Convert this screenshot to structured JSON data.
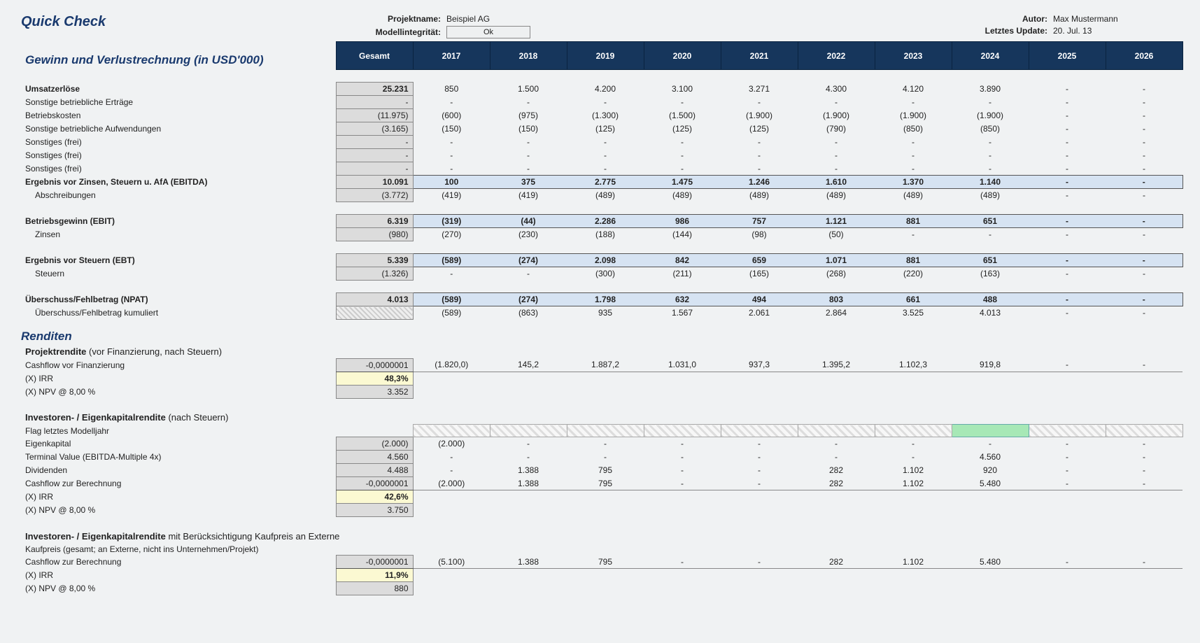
{
  "header": {
    "title": "Quick Check",
    "projectLabel": "Projektname:",
    "project": "Beispiel AG",
    "integrityLabel": "Modellintegrität:",
    "integrity": "Ok",
    "authorLabel": "Autor:",
    "author": "Max Mustermann",
    "updateLabel": "Letztes Update:",
    "update": "20. Jul. 13"
  },
  "section1": "Gewinn und Verlustrechnung (in USD'000)",
  "cols": {
    "gesamt": "Gesamt",
    "y": [
      "2017",
      "2018",
      "2019",
      "2020",
      "2021",
      "2022",
      "2023",
      "2024",
      "2025",
      "2026"
    ]
  },
  "pl": {
    "r1": {
      "lbl": "Umsatzerlöse",
      "g": "25.231",
      "v": [
        "850",
        "1.500",
        "4.200",
        "3.100",
        "3.271",
        "4.300",
        "4.120",
        "3.890",
        "-",
        "-"
      ]
    },
    "r2": {
      "lbl": "Sonstige betriebliche Erträge",
      "g": "-",
      "v": [
        "-",
        "-",
        "-",
        "-",
        "-",
        "-",
        "-",
        "-",
        "-",
        "-"
      ]
    },
    "r3": {
      "lbl": "Betriebskosten",
      "g": "(11.975)",
      "v": [
        "(600)",
        "(975)",
        "(1.300)",
        "(1.500)",
        "(1.900)",
        "(1.900)",
        "(1.900)",
        "(1.900)",
        "-",
        "-"
      ]
    },
    "r4": {
      "lbl": "Sonstige betriebliche Aufwendungen",
      "g": "(3.165)",
      "v": [
        "(150)",
        "(150)",
        "(125)",
        "(125)",
        "(125)",
        "(790)",
        "(850)",
        "(850)",
        "-",
        "-"
      ]
    },
    "r5": {
      "lbl": "Sonstiges (frei)",
      "g": "-",
      "v": [
        "-",
        "-",
        "-",
        "-",
        "-",
        "-",
        "-",
        "-",
        "-",
        "-"
      ]
    },
    "r6": {
      "lbl": "Sonstiges (frei)",
      "g": "-",
      "v": [
        "-",
        "-",
        "-",
        "-",
        "-",
        "-",
        "-",
        "-",
        "-",
        "-"
      ]
    },
    "r7": {
      "lbl": "Sonstiges (frei)",
      "g": "-",
      "v": [
        "-",
        "-",
        "-",
        "-",
        "-",
        "-",
        "-",
        "-",
        "-",
        "-"
      ]
    },
    "r8": {
      "lbl": "Ergebnis vor Zinsen, Steuern u. AfA (EBITDA)",
      "g": "10.091",
      "v": [
        "100",
        "375",
        "2.775",
        "1.475",
        "1.246",
        "1.610",
        "1.370",
        "1.140",
        "-",
        "-"
      ]
    },
    "r9": {
      "lbl": "Abschreibungen",
      "g": "(3.772)",
      "v": [
        "(419)",
        "(419)",
        "(489)",
        "(489)",
        "(489)",
        "(489)",
        "(489)",
        "(489)",
        "-",
        "-"
      ]
    },
    "r10": {
      "lbl": "Betriebsgewinn (EBIT)",
      "g": "6.319",
      "v": [
        "(319)",
        "(44)",
        "2.286",
        "986",
        "757",
        "1.121",
        "881",
        "651",
        "-",
        "-"
      ]
    },
    "r11": {
      "lbl": "Zinsen",
      "g": "(980)",
      "v": [
        "(270)",
        "(230)",
        "(188)",
        "(144)",
        "(98)",
        "(50)",
        "-",
        "-",
        "-",
        "-"
      ]
    },
    "r12": {
      "lbl": "Ergebnis vor Steuern (EBT)",
      "g": "5.339",
      "v": [
        "(589)",
        "(274)",
        "2.098",
        "842",
        "659",
        "1.071",
        "881",
        "651",
        "-",
        "-"
      ]
    },
    "r13": {
      "lbl": "Steuern",
      "g": "(1.326)",
      "v": [
        "-",
        "-",
        "(300)",
        "(211)",
        "(165)",
        "(268)",
        "(220)",
        "(163)",
        "-",
        "-"
      ]
    },
    "r14": {
      "lbl": "Überschuss/Fehlbetrag (NPAT)",
      "g": "4.013",
      "v": [
        "(589)",
        "(274)",
        "1.798",
        "632",
        "494",
        "803",
        "661",
        "488",
        "-",
        "-"
      ]
    },
    "r15": {
      "lbl": "Überschuss/Fehlbetrag kumuliert",
      "g": "",
      "v": [
        "(589)",
        "(863)",
        "935",
        "1.567",
        "2.061",
        "2.864",
        "3.525",
        "4.013",
        "-",
        "-"
      ]
    }
  },
  "section2": "Renditen",
  "ret1": {
    "title": "Projektrendite",
    "suffix": "(vor Finanzierung, nach Steuern)",
    "cf": {
      "lbl": "Cashflow vor Finanzierung",
      "g": "-0,0000001",
      "v": [
        "(1.820,0)",
        "145,2",
        "1.887,2",
        "1.031,0",
        "937,3",
        "1.395,2",
        "1.102,3",
        "919,8",
        "-",
        "-"
      ]
    },
    "irr": {
      "lbl": "(X) IRR",
      "g": "48,3%"
    },
    "npv": {
      "lbl": "(X) NPV @  8,00 %",
      "g": "3.352"
    }
  },
  "ret2": {
    "title": "Investoren- / Eigenkapitalrendite",
    "suffix": "(nach Steuern)",
    "flag": {
      "lbl": "Flag letztes Modelljahr",
      "greenIdx": 7
    },
    "ek": {
      "lbl": "Eigenkapital",
      "g": "(2.000)",
      "v": [
        "(2.000)",
        "-",
        "-",
        "-",
        "-",
        "-",
        "-",
        "-",
        "-",
        "-"
      ]
    },
    "tv": {
      "lbl": "Terminal Value (EBITDA-Multiple 4x)",
      "g": "4.560",
      "v": [
        "-",
        "-",
        "-",
        "-",
        "-",
        "-",
        "-",
        "4.560",
        "-",
        "-"
      ]
    },
    "div": {
      "lbl": "Dividenden",
      "g": "4.488",
      "v": [
        "-",
        "1.388",
        "795",
        "-",
        "-",
        "282",
        "1.102",
        "920",
        "-",
        "-"
      ]
    },
    "cf": {
      "lbl": "Cashflow zur Berechnung",
      "g": "-0,0000001",
      "v": [
        "(2.000)",
        "1.388",
        "795",
        "-",
        "-",
        "282",
        "1.102",
        "5.480",
        "-",
        "-"
      ]
    },
    "irr": {
      "lbl": "(X) IRR",
      "g": "42,6%"
    },
    "npv": {
      "lbl": "(X) NPV @  8,00 %",
      "g": "3.750"
    }
  },
  "ret3": {
    "title": "Investoren- / Eigenkapitalrendite",
    "suffix": "mit Berücksichtigung Kaufpreis an Externe",
    "kp": {
      "lbl": "Kaufpreis (gesamt; an Externe, nicht ins Unternehmen/Projekt)"
    },
    "cf": {
      "lbl": "Cashflow zur Berechnung",
      "g": "-0,0000001",
      "v": [
        "(5.100)",
        "1.388",
        "795",
        "-",
        "-",
        "282",
        "1.102",
        "5.480",
        "-",
        "-"
      ]
    },
    "irr": {
      "lbl": "(X) IRR",
      "g": "11,9%"
    },
    "npv": {
      "lbl": "(X) NPV @  8,00 %",
      "g": "880"
    }
  }
}
